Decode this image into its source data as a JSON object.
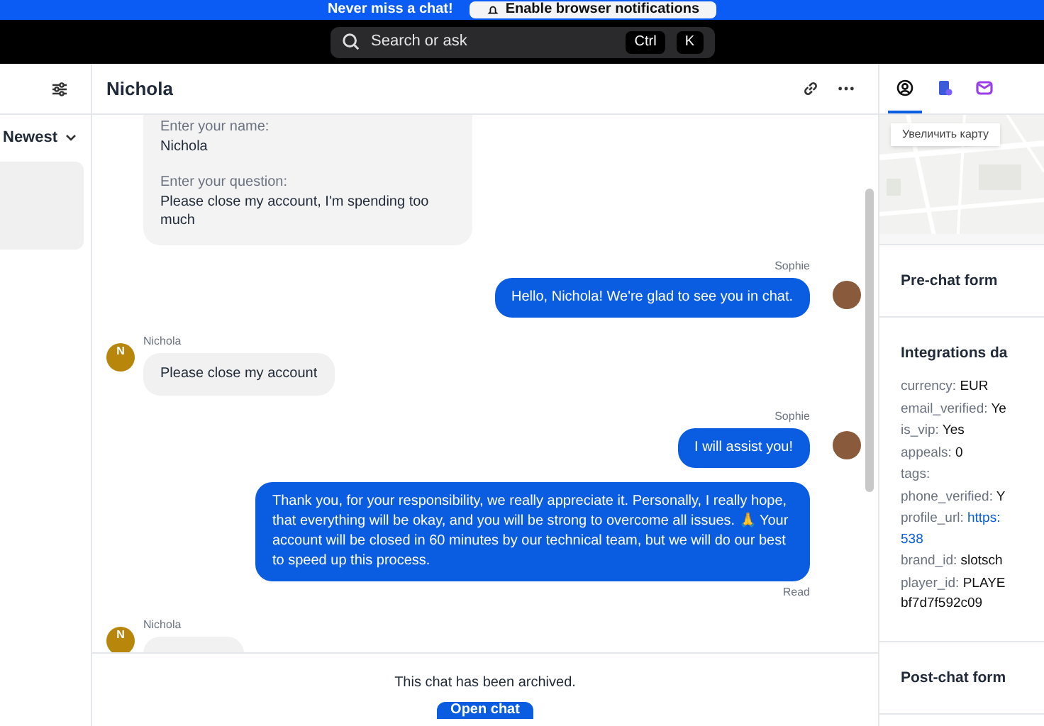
{
  "banner": {
    "text": "Never miss a chat!",
    "button": "Enable browser notifications"
  },
  "search": {
    "placeholder": "Search or ask",
    "keys": [
      "Ctrl",
      "K"
    ]
  },
  "sidebar": {
    "sort": "Newest"
  },
  "chat": {
    "title": "Nichola",
    "messages": [
      {
        "kind": "form",
        "fields": [
          {
            "label": "Enter your name:",
            "value": "Nichola"
          },
          {
            "label": "Enter your question:",
            "value": "Please close my account, I'm spending too much"
          }
        ]
      },
      {
        "kind": "agent",
        "author": "Sophie",
        "text": "Hello, Nichola! We're glad to see you in chat."
      },
      {
        "kind": "visitor",
        "author": "Nichola",
        "initial": "N",
        "text": "Please close my account"
      },
      {
        "kind": "agent",
        "author": "Sophie",
        "text": "I will assist you!"
      },
      {
        "kind": "agent",
        "text": "Thank you, for your responsibility, we really appreciate it. Personally, I really hope, that everything will be okay, and you will be strong to overcome all issues. 🙏 Your account will be closed in 60 minutes by our technical team, but we will do our best to speed up this process.",
        "status": "Read"
      },
      {
        "kind": "visitor",
        "author": "Nichola",
        "initial": "N"
      }
    ],
    "archived": {
      "text": "This chat has been archived.",
      "button": "Open chat"
    }
  },
  "details": {
    "tabs": [
      {
        "selected": true
      },
      {
        "selected": false
      },
      {
        "selected": false
      }
    ],
    "map_button": "Увеличить карту",
    "sections": [
      {
        "title": "Pre-chat form"
      },
      {
        "title": "Integrations da",
        "rows": [
          {
            "key": "currency:",
            "value": "EUR"
          },
          {
            "key": "email_verified:",
            "value": "Ye"
          },
          {
            "key": "is_vip:",
            "value": "Yes"
          },
          {
            "key": "appeals:",
            "value": "0"
          },
          {
            "key": "tags:"
          },
          {
            "key": "phone_verified:",
            "value": "Y"
          },
          {
            "key": "profile_url:",
            "value": "https:",
            "link": true,
            "cont": "538"
          },
          {
            "key": "brand_id:",
            "value": "slotsch"
          },
          {
            "key": "player_id:",
            "value": "PLAYE",
            "cont": "bf7d7f592c09"
          }
        ]
      },
      {
        "title": "Post-chat form"
      }
    ]
  }
}
